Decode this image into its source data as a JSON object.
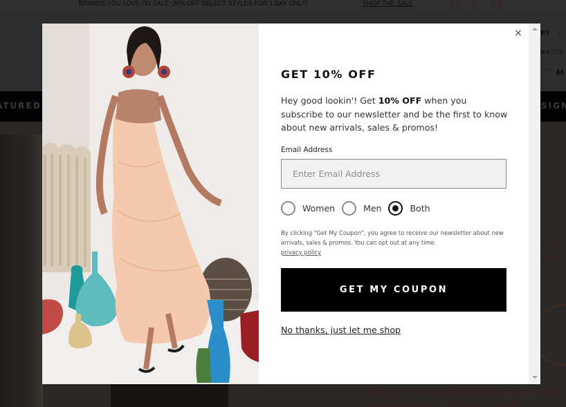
{
  "promo_bar": {
    "text": "BRANDS YOU LOVE ON SALE: 20% OFF SELECT STYLES FOR 1 DAY ONLY!",
    "link": "SHOP THE SALE",
    "countdown": "0 : 12 : 10 : 06"
  },
  "background": {
    "header_help": "P?",
    "header_nation": "NATIO",
    "header_my": "M",
    "nav_left": "ATURED",
    "nav_right": "SIGN",
    "hero_side_text": "O N",
    "hero_headline": "SELECT STYLES FROM FOR LOVE",
    "hero_subline": "FREE PEOPLE, AGOLDE + MORE"
  },
  "modal": {
    "image_alt": "Model in a peach tiered maxi dress among colorful glass vases",
    "close_label": "×",
    "title": "GET 10% OFF",
    "intro_pre": "Hey good lookin'! Get ",
    "intro_bold": "10% OFF",
    "intro_post": " when you subscribe to our newsletter and be the first to know about new arrivals, sales & promos!",
    "email_label": "Email Address",
    "email_value": "",
    "email_placeholder": "Enter Email Address",
    "gender_options": [
      {
        "label": "Women",
        "checked": false
      },
      {
        "label": "Men",
        "checked": false
      },
      {
        "label": "Both",
        "checked": true
      }
    ],
    "legal_text": "By clicking \"Get My Coupon\", you agree to receive our newsletter about new arrivals, sales & promos. You can opt out at any time.",
    "privacy_link": "privacy policy",
    "submit_label": "GET MY COUPON",
    "dismiss_label": "No thanks, just let me shop"
  },
  "colors": {
    "overlay": "#2e2e2e",
    "button_bg": "#000000",
    "button_text": "#ffffff",
    "input_bg": "#f2f2f2"
  }
}
